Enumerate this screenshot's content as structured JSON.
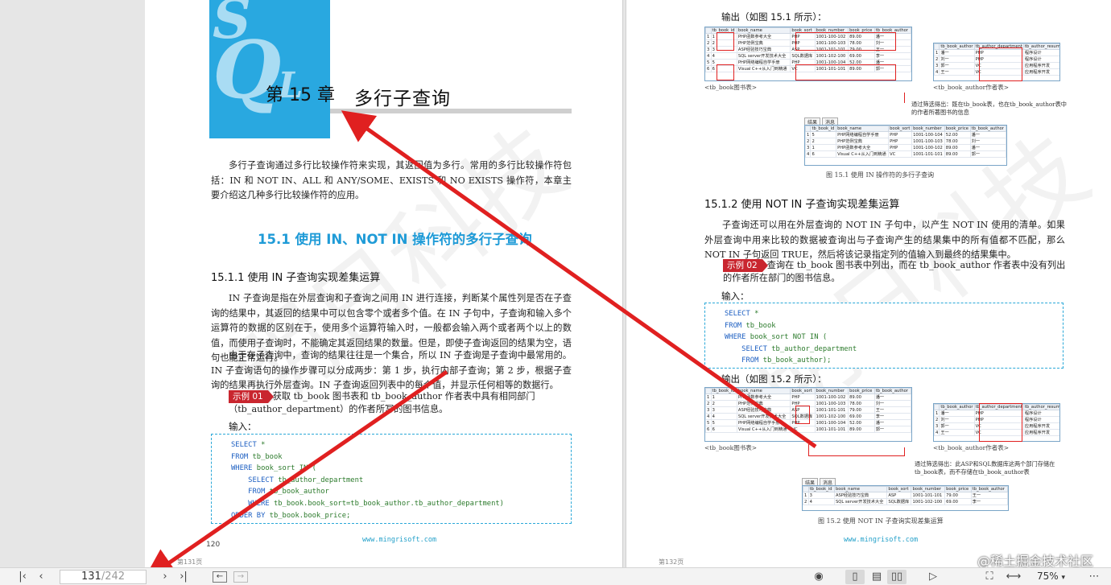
{
  "left_page": {
    "chapter_letters": [
      "S",
      "Q",
      "L"
    ],
    "chapter_number": "第 15 章",
    "chapter_title": "多行子查询",
    "intro": "多行子查询通过多行比较操作符来实现，其返回值为多行。常用的多行比较操作符包括：IN 和 NOT IN、ALL 和 ANY/SOME、EXISTS 和 NO EXISTS 操作符，本章主要介绍这几种多行比较操作符的应用。",
    "section_title": "15.1  使用 IN、NOT IN 操作符的多行子查询",
    "subsection_title": "15.1.1  使用 IN 子查询实现差集运算",
    "para1": "IN 子查询是指在外层查询和子查询之间用 IN 进行连接，判断某个属性列是否在子查询的结果中，其返回的结果中可以包含零个或者多个值。在 IN 子句中，子查询和输入多个运算符的数据的区别在于，使用多个运算符输入时，一般都会输入两个或者两个以上的数值，而使用子查询时，不能确定其返回结果的数量。但是，即使子查询返回的结果为空，语句也能正常运行。",
    "para2": "由于在子查询中，查询的结果往往是一个集合，所以 IN 子查询是子查询中最常用的。IN 子查询语句的操作步骤可以分成两步：第 1 步，执行内部子查询；第 2 步，根据子查询的结果再执行外层查询。IN 子查询返回列表中的每个值，并显示任何相等的数据行。",
    "example_tag": "示例 01",
    "example_text": "获取 tb_book 图书表和 tb_book_author 作者表中具有相同部门（tb_author_department）的作者所写的图书信息。",
    "input_label": "输入：",
    "code": [
      {
        "kw": "SELECT",
        "rest": " *"
      },
      {
        "kw": "FROM",
        "rest": " tb_book"
      },
      {
        "kw": "WHERE",
        "rest": " book_sort IN ("
      },
      {
        "kw": "    SELECT",
        "rest": " tb_author_department"
      },
      {
        "kw": "    FROM",
        "rest": " tb_book_author"
      },
      {
        "kw": "    WHERE",
        "rest": " tb_book.book_sort=tb_book_author.tb_author_department)"
      },
      {
        "kw": "ORDER BY",
        "rest": " tb_book.book_price;"
      }
    ],
    "footer_url": "www.mingrisoft.com",
    "page_number": "120",
    "page_label": "第131页"
  },
  "right_page": {
    "output_label_1": "输出（如图 15.1 所示）：",
    "book_table": {
      "headers": [
        "",
        "tb_book_id",
        "book_name",
        "book_sort",
        "book_number",
        "book_price",
        "tb_book_author"
      ],
      "rows": [
        [
          "1",
          "1",
          "PHP函数参考大全",
          "PHP",
          "1001-100-102",
          "89.00",
          "潘一"
        ],
        [
          "2",
          "2",
          "PHP范例宝典",
          "PHP",
          "1001-100-103",
          "78.00",
          "刘一"
        ],
        [
          "3",
          "3",
          "ASP经验技巧宝典",
          "ASP",
          "1001-101-101",
          "79.00",
          "王一"
        ],
        [
          "4",
          "4",
          "SQL server开发技术大全",
          "SQL数据库",
          "1001-102-100",
          "69.00",
          "李一"
        ],
        [
          "5",
          "5",
          "PHP网络编程自学手册",
          "PHP",
          "1001-100-104",
          "52.00",
          "潘一"
        ],
        [
          "6",
          "6",
          "Visual C++从入门到精通",
          "VC",
          "1001-101-101",
          "89.00",
          "郭一"
        ]
      ]
    },
    "author_table": {
      "headers": [
        "",
        "tb_book_author",
        "tb_author_department",
        "tb_author_resume"
      ],
      "rows": [
        [
          "1",
          "潘一",
          "PHP",
          "程序设计"
        ],
        [
          "2",
          "刘一",
          "PHP",
          "程序设计"
        ],
        [
          "3",
          "郭一",
          "VC",
          "应用程序开发"
        ],
        [
          "4",
          "王一",
          "VC",
          "应用程序开发"
        ]
      ]
    },
    "caption_book": "<tb_book图书表>",
    "caption_author": "<tb_book_author作者表>",
    "note_1": "通过筛选得出：既在tb_book表，也在tb_book_author表中的作者所著图书的信息",
    "result_tabs": [
      "结果",
      "消息"
    ],
    "result_table_1": {
      "headers": [
        "",
        "tb_book_id",
        "book_name",
        "book_sort",
        "book_number",
        "book_price",
        "tb_book_author"
      ],
      "rows": [
        [
          "1",
          "5",
          "PHP网络编程自学手册",
          "PHP",
          "1001-100-104",
          "52.00",
          "潘一"
        ],
        [
          "2",
          "2",
          "PHP范例宝典",
          "PHP",
          "1001-100-103",
          "78.00",
          "刘一"
        ],
        [
          "3",
          "1",
          "PHP函数参考大全",
          "PHP",
          "1001-100-102",
          "89.00",
          "潘一"
        ],
        [
          "4",
          "6",
          "Visual C++从入门到精通",
          "VC",
          "1001-101-101",
          "89.00",
          "郭一"
        ]
      ]
    },
    "figure_1_caption": "图 15.1   使用 IN 操作符的多行子查询",
    "subsection_title": "15.1.2  使用 NOT IN 子查询实现差集运算",
    "para": "子查询还可以用在外层查询的 NOT IN 子句中，以产生 NOT IN 使用的清单。如果外层查询中用来比较的数据被查询出与子查询产生的结果集中的所有值都不匹配，那么 NOT IN 子句返回 TRUE，然后将该记录指定列的值输入到最终的结果集中。",
    "example_tag": "示例 02",
    "example_text": "查询在 tb_book 图书表中列出，而在 tb_book_author 作者表中没有列出的作者所在部门的图书信息。",
    "input_label": "输入：",
    "code": [
      {
        "kw": "SELECT",
        "rest": " *"
      },
      {
        "kw": "FROM",
        "rest": " tb_book"
      },
      {
        "kw": "WHERE",
        "rest": " book_sort NOT IN ("
      },
      {
        "kw": "    SELECT",
        "rest": " tb_author_department"
      },
      {
        "kw": "    FROM",
        "rest": " tb_book_author);"
      }
    ],
    "output_label_2": "输出（如图 15.2 所示）：",
    "note_2": "通过筛选得出：此ASP和SQL数据库这两个部门存储在tb_book表，而不存储在tb_book_author表",
    "result_table_2": {
      "headers": [
        "",
        "tb_book_id",
        "book_name",
        "book_sort",
        "book_number",
        "book_price",
        "tb_book_author"
      ],
      "rows": [
        [
          "1",
          "3",
          "ASP经验技巧宝典",
          "ASP",
          "1001-101-101",
          "79.00",
          "王一"
        ],
        [
          "2",
          "4",
          "SQL server开发技术大全",
          "SQL数据库",
          "1001-102-100",
          "69.00",
          "李一"
        ]
      ]
    },
    "figure_2_caption": "图 15.2   使用 NOT IN 子查询实现差集运算",
    "footer_url": "www.mingrisoft.com",
    "page_label": "第132页"
  },
  "toolbar": {
    "current_page": "131",
    "total_pages": "/242",
    "zoom": "75%"
  },
  "watermark_brand": "@稀土掘金技术社区",
  "colors": {
    "accent": "#29a8e0",
    "arrow": "#e02020",
    "example_tag": "#c9262f"
  },
  "icons": [
    "first-page-icon",
    "prev-page-icon",
    "next-page-icon",
    "last-page-icon",
    "back-icon",
    "forward-icon",
    "eye-icon",
    "single-page-icon",
    "scroll-page-icon",
    "two-page-icon",
    "play-icon",
    "fit-page-icon",
    "fit-width-icon",
    "chevron-down-icon",
    "more-icon"
  ]
}
